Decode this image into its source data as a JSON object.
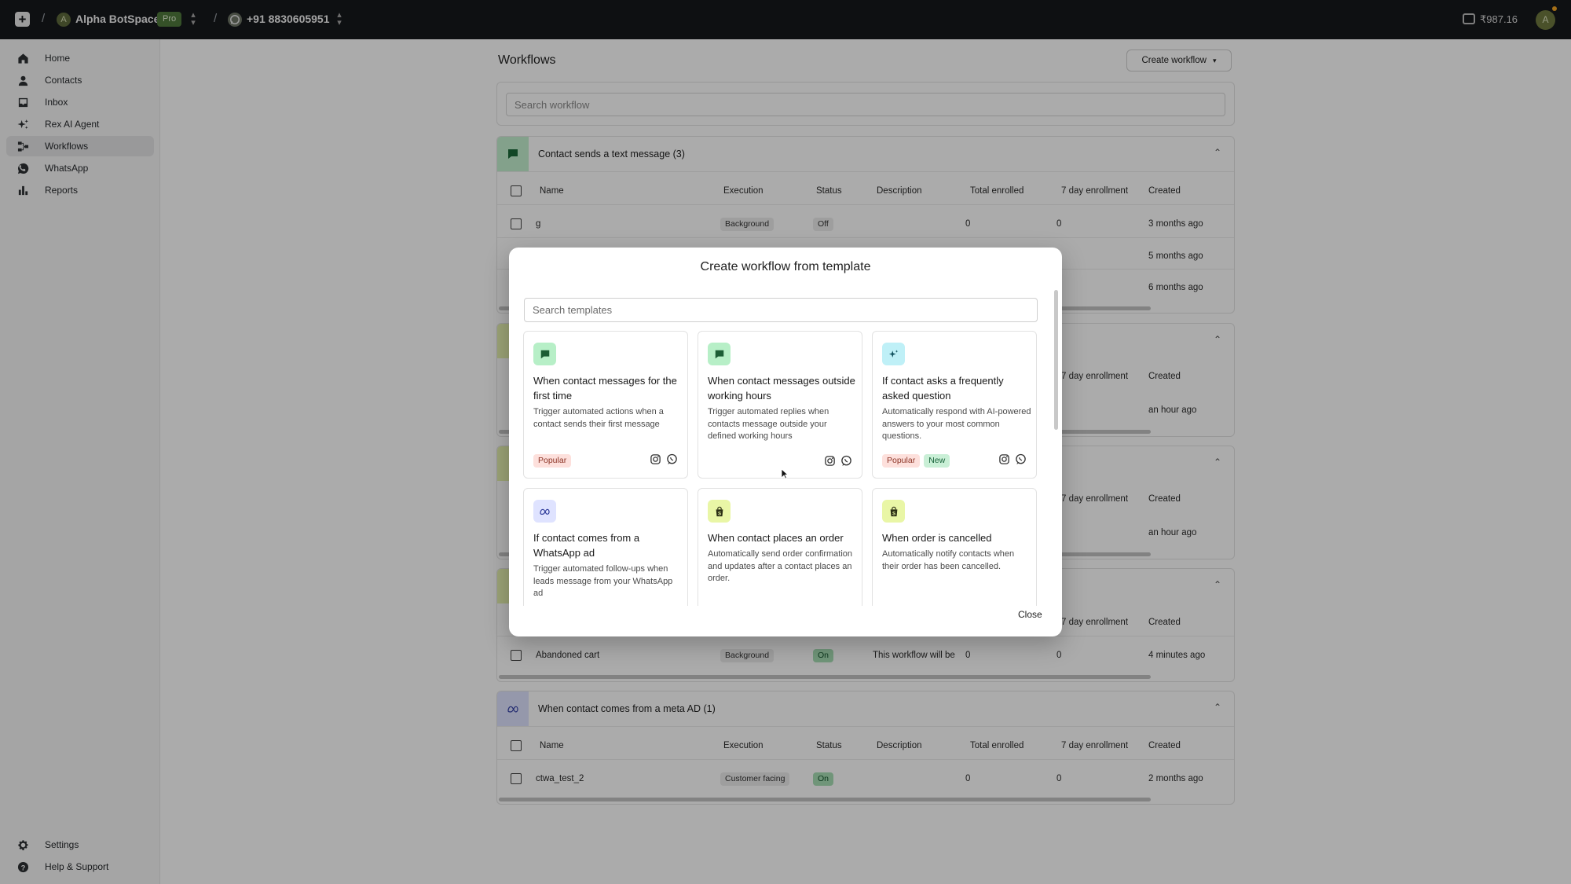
{
  "topbar": {
    "sep1": "/",
    "sep2": "/",
    "workspace_initial": "A",
    "workspace_name": "Alpha BotSpace",
    "plan_badge": "Pro",
    "phone": "+91 8830605951",
    "balance": "₹987.16",
    "user_initial": "A"
  },
  "sidebar": {
    "items": [
      {
        "label": "Home",
        "icon": "home-icon"
      },
      {
        "label": "Contacts",
        "icon": "contacts-icon"
      },
      {
        "label": "Inbox",
        "icon": "inbox-icon"
      },
      {
        "label": "Rex AI Agent",
        "icon": "sparkle-icon"
      },
      {
        "label": "Workflows",
        "icon": "workflows-icon",
        "active": true
      },
      {
        "label": "WhatsApp",
        "icon": "whatsapp-icon"
      },
      {
        "label": "Reports",
        "icon": "bar-chart-icon"
      }
    ],
    "bottom": [
      {
        "label": "Settings",
        "icon": "gear-icon"
      },
      {
        "label": "Help & Support",
        "icon": "help-icon"
      }
    ]
  },
  "main": {
    "title": "Workflows",
    "create_button": "Create workflow",
    "search_placeholder": "Search workflow",
    "columns": [
      "Name",
      "Execution",
      "Status",
      "Description",
      "Total enrolled",
      "7 day enrollment",
      "Created"
    ],
    "groups": [
      {
        "title": "Contact sends a text message (3)",
        "rows": [
          {
            "name": "g",
            "execution": "Background",
            "status": "Off",
            "description": "",
            "total": "0",
            "seven_day": "0",
            "created": "3 months ago"
          },
          {
            "created": "5 months ago"
          },
          {
            "created": "6 months ago"
          }
        ]
      },
      {
        "seven_day_header": "7 day enrollment",
        "created_header": "Created",
        "row_created": "an hour ago"
      },
      {
        "seven_day_header": "7 day enrollment",
        "created_header": "Created",
        "row_created": "an hour ago"
      },
      {
        "seven_day_header": "7 day enrollment",
        "created_header": "Created",
        "row": {
          "name": "Abandoned cart",
          "execution": "Background",
          "status": "On",
          "description": "This workflow will be",
          "total": "0",
          "seven_day": "0",
          "created": "4 minutes ago"
        }
      },
      {
        "title": "When contact comes from a meta AD (1)",
        "row": {
          "name": "ctwa_test_2",
          "execution": "Customer facing",
          "status": "On",
          "description": "",
          "total": "0",
          "seven_day": "0",
          "created": "2 months ago"
        }
      }
    ]
  },
  "modal": {
    "title": "Create workflow from template",
    "search_placeholder": "Search templates",
    "close_label": "Close",
    "templates": [
      {
        "title": "When contact messages for the first time",
        "description": "Trigger automated actions when a contact sends their first message",
        "tags": [
          "Popular"
        ],
        "icon": "chat-icon",
        "color": "#b7efc7"
      },
      {
        "title": "When contact messages outside working hours",
        "description": "Trigger automated replies when contacts message outside your defined working hours",
        "tags": [],
        "icon": "chat-icon",
        "color": "#b7efc7"
      },
      {
        "title": "If contact asks a frequently asked question",
        "description": "Automatically respond with AI-powered answers to your most common questions.",
        "tags": [
          "Popular",
          "New"
        ],
        "icon": "sparkle-icon",
        "color": "#bff0f7"
      },
      {
        "title": "If contact comes from a WhatsApp ad",
        "description": "Trigger automated follow-ups when leads message from your WhatsApp ad",
        "tags": [],
        "icon": "meta-icon",
        "color": "#dfe3ff"
      },
      {
        "title": "When contact places an order",
        "description": "Automatically send order confirmation and updates after a contact places an order.",
        "tags": [],
        "icon": "shopify-bag-icon",
        "color": "#e9f6a6"
      },
      {
        "title": "When order is cancelled",
        "description": "Automatically notify contacts when their order has been cancelled.",
        "tags": [],
        "icon": "shopify-bag-icon",
        "color": "#e9f6a6"
      }
    ]
  }
}
